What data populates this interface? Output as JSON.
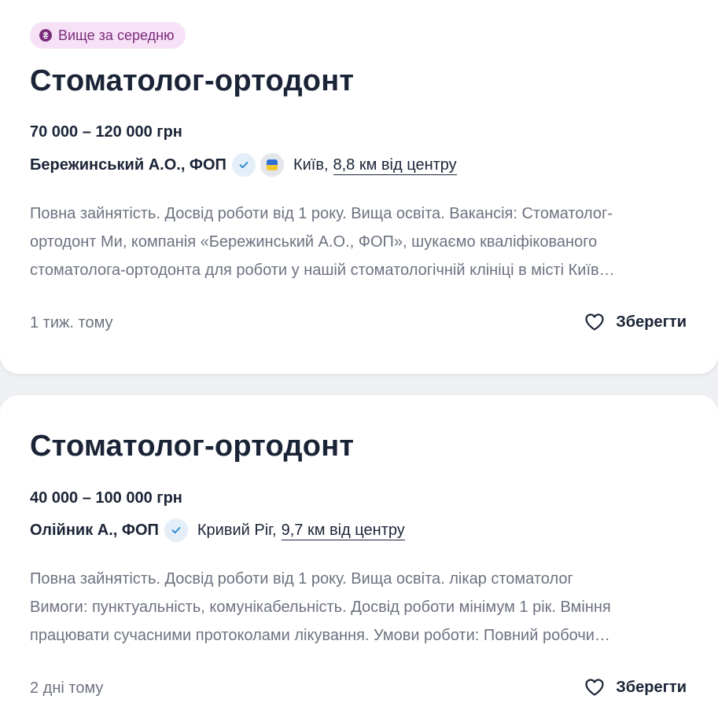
{
  "vacancies": [
    {
      "badge": "Вище за середню",
      "title": "Стоматолог-ортодонт",
      "salary": "70 000 – 120 000 грн",
      "company": "Бережинський А.О., ФОП",
      "city": "Київ,",
      "distance": "8,8 км від центру",
      "description_lines": [
        "Повна зайнятість. Досвід роботи від 1 року. Вища освіта. Вакансія: Стоматолог-",
        "ортодонт Ми, компанія «Бережинський А.О., ФОП», шукаємо кваліфікованого",
        "стоматолога-ортодонта для роботи у нашій стоматологічній клініці в місті Київ…"
      ],
      "date": "1 тиж. тому",
      "save_label": "Зберегти"
    },
    {
      "title": "Стоматолог-ортодонт",
      "salary": "40 000 – 100 000 грн",
      "company": "Олійник А., ФОП",
      "city": "Кривий Ріг,",
      "distance": "9,7 км від центру",
      "description_lines": [
        "Повна зайнятість. Досвід роботи від 1 року. Вища освіта. лікар стоматолог",
        "Вимоги: пунктуальність, комунікабельність. Досвід роботи мінімум 1 рік. Вміння",
        "працювати сучасними протоколами лікування. Умови роботи: Повний робочи…"
      ],
      "date": "2 дні тому",
      "save_label": "Зберегти"
    }
  ],
  "icons": {
    "badge": "hryvnia-coin-icon",
    "verified": "verified-check-icon",
    "flag": "ukraine-flag-icon",
    "save": "heart-icon"
  },
  "colors": {
    "badge_bg": "#f7e1f7",
    "badge_text": "#7a2c7a",
    "title": "#1b2437",
    "description": "#6c7280",
    "verified": "#1f86d1"
  }
}
